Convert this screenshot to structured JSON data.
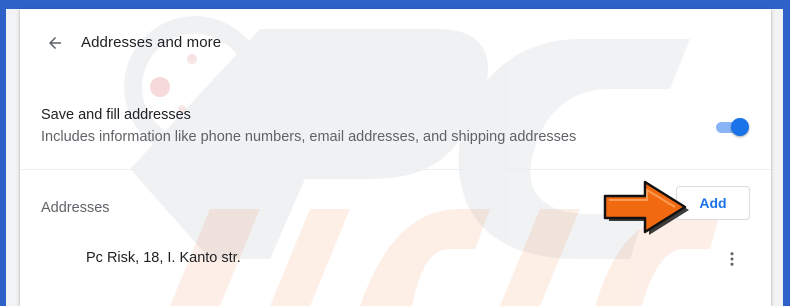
{
  "header": {
    "title": "Addresses and more",
    "back_icon": "arrow-back-icon"
  },
  "save_setting": {
    "title": "Save and fill addresses",
    "description": "Includes information like phone numbers, email addresses, and shipping addresses",
    "toggle_on": true
  },
  "addresses_section": {
    "title": "Addresses",
    "add_label": "Add",
    "items": [
      {
        "text": "Pc Risk, 18, I. Kanto str."
      }
    ]
  },
  "colors": {
    "accent": "#1a73e8",
    "frame_border": "#2f62c8",
    "annotation_arrow": "#f26a10"
  }
}
